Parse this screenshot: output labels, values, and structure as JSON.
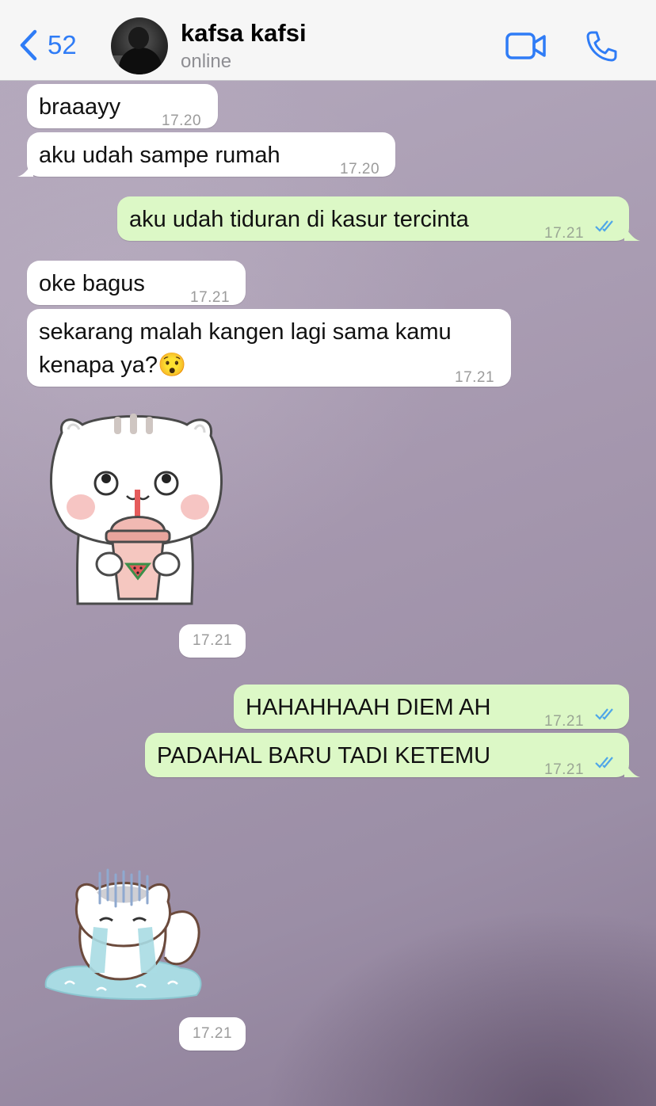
{
  "header": {
    "back_count": "52",
    "contact_name": "kafsa kafsi",
    "contact_status": "online"
  },
  "colors": {
    "accent": "#2f7cf6",
    "incoming_bubble": "#ffffff",
    "outgoing_bubble": "#dcf8c6",
    "read_ticks": "#4fa6e8"
  },
  "messages": [
    {
      "dir": "in",
      "text": "braaayy",
      "time": "17.20"
    },
    {
      "dir": "in",
      "text": "aku udah sampe rumah",
      "time": "17.20"
    },
    {
      "dir": "out",
      "text": "aku udah tiduran di kasur tercinta",
      "time": "17.21",
      "status": "read"
    },
    {
      "dir": "in",
      "text": "oke bagus",
      "time": "17.21"
    },
    {
      "dir": "in",
      "text_line1": "sekarang malah kangen lagi sama kamu",
      "text_line2": "kenapa ya?",
      "emoji": "😯",
      "time": "17.21"
    },
    {
      "dir": "in",
      "type": "sticker",
      "sticker": "cat-drinking-watermelon-juice",
      "time": "17.21"
    },
    {
      "dir": "out",
      "text": "HAHAHHAAH DIEM AH",
      "time": "17.21",
      "status": "read"
    },
    {
      "dir": "out",
      "text": "PADAHAL BARU TADI KETEMU",
      "time": "17.21",
      "status": "read"
    },
    {
      "dir": "in",
      "type": "sticker",
      "sticker": "cat-crying-puddle",
      "time": "17.21"
    }
  ]
}
